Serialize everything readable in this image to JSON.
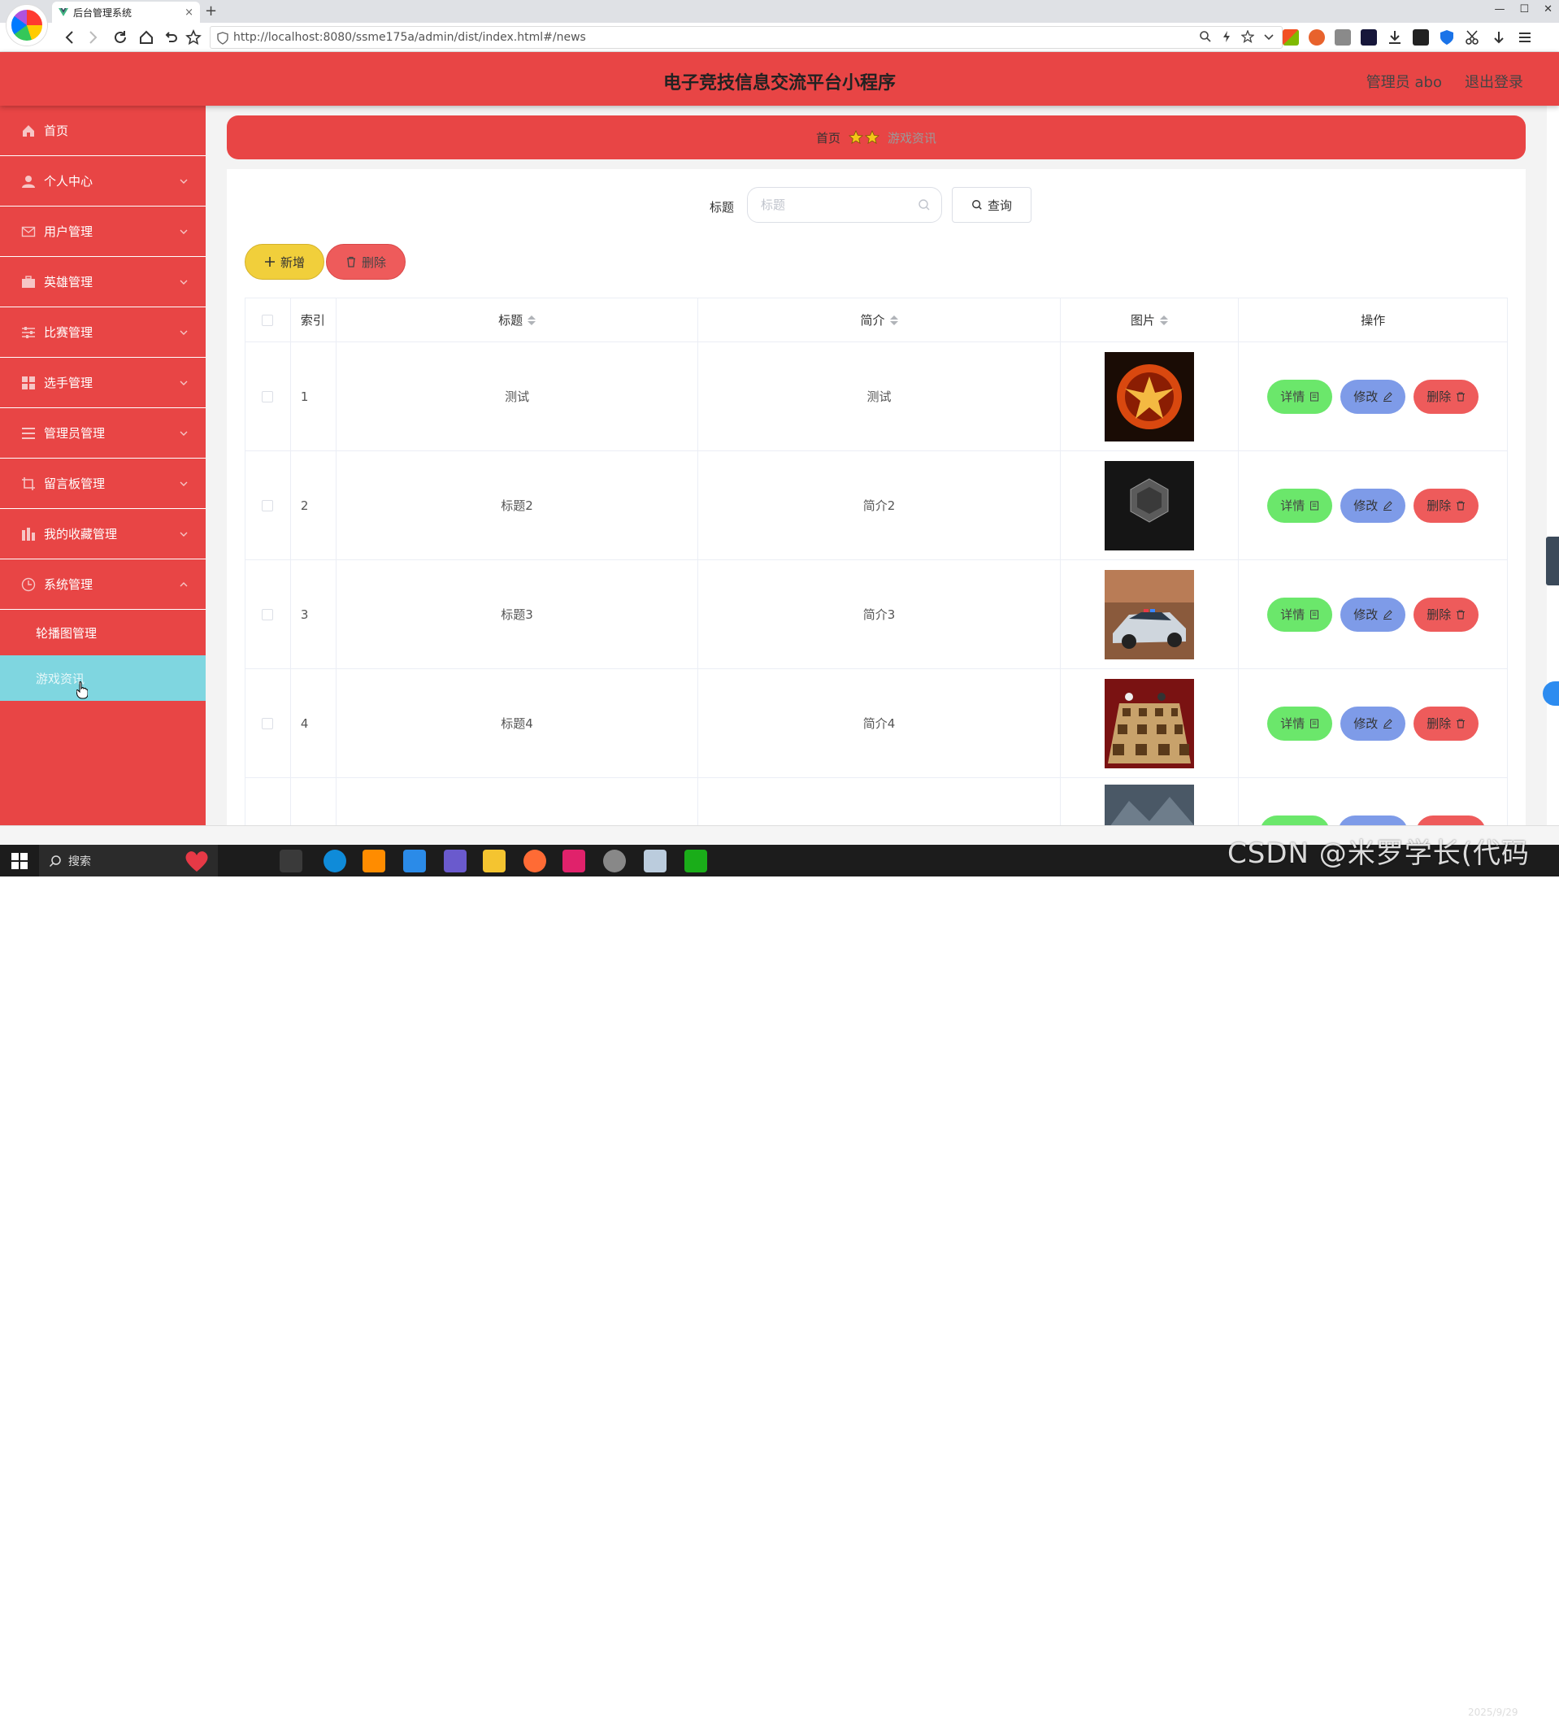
{
  "browser": {
    "tab_title": "后台管理系统",
    "tab_close": "×",
    "new_tab": "+",
    "url": "http://localhost:8080/ssme175a/admin/dist/index.html#/news"
  },
  "header": {
    "title": "电子竞技信息交流平台小程序",
    "admin": "管理员 abo",
    "logout": "退出登录"
  },
  "sidebar": {
    "items": [
      {
        "label": "首页",
        "icon": "home-icon"
      },
      {
        "label": "个人中心",
        "icon": "user-icon"
      },
      {
        "label": "用户管理",
        "icon": "mail-icon"
      },
      {
        "label": "英雄管理",
        "icon": "briefcase-icon"
      },
      {
        "label": "比赛管理",
        "icon": "sliders-icon"
      },
      {
        "label": "选手管理",
        "icon": "grid-icon"
      },
      {
        "label": "管理员管理",
        "icon": "list-icon"
      },
      {
        "label": "留言板管理",
        "icon": "crop-icon"
      },
      {
        "label": "我的收藏管理",
        "icon": "bar-chart-icon"
      },
      {
        "label": "系统管理",
        "icon": "clock-icon"
      }
    ],
    "sub_items": [
      "轮播图管理",
      "游戏资讯"
    ]
  },
  "breadcrumb": {
    "home": "首页",
    "current": "游戏资讯"
  },
  "search": {
    "label": "标题",
    "placeholder": "标题",
    "button": "查询"
  },
  "actions": {
    "add": "新增",
    "delete": "删除"
  },
  "table": {
    "headers": {
      "index": "索引",
      "title": "标题",
      "desc": "简介",
      "image": "图片",
      "ops": "操作"
    },
    "rows": [
      {
        "index": "1",
        "title": "测试",
        "desc": "测试"
      },
      {
        "index": "2",
        "title": "标题2",
        "desc": "简介2"
      },
      {
        "index": "3",
        "title": "标题3",
        "desc": "简介3"
      },
      {
        "index": "4",
        "title": "标题4",
        "desc": "简介4"
      }
    ],
    "ops": {
      "detail": "详情",
      "edit": "修改",
      "delete": "删除"
    }
  },
  "taskbar": {
    "search": "搜索",
    "date": "2025/9/29"
  },
  "watermark": "CSDN @米罗学长(代码",
  "colors": {
    "primary": "#e84545",
    "active_sub": "#7fd6e0",
    "detail": "#6be76b",
    "edit": "#7e9be8",
    "delete": "#ee5b5b",
    "add": "#f1cf3b"
  }
}
